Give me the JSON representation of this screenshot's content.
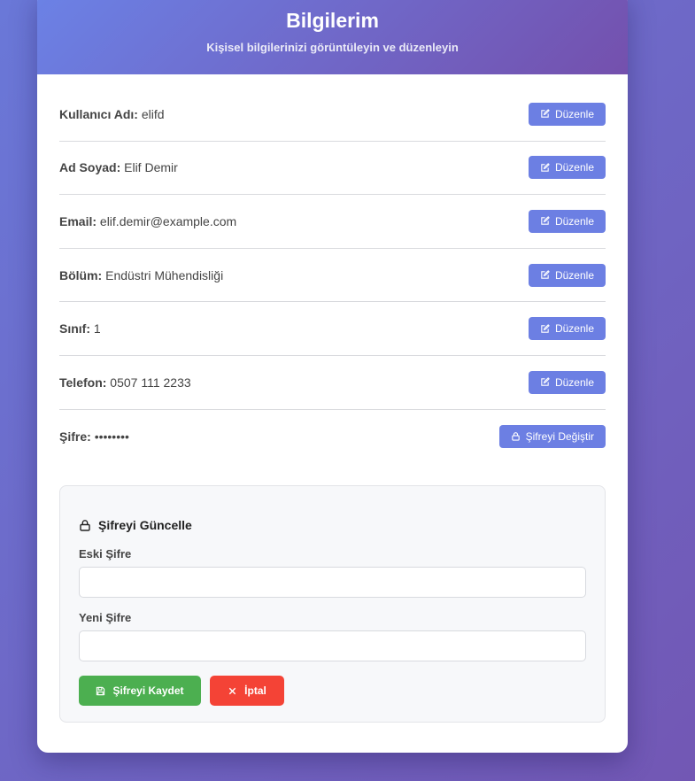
{
  "header": {
    "title": "Bilgilerim",
    "subtitle": "Kişisel bilgilerinizi görüntüleyin ve düzenleyin"
  },
  "fields": [
    {
      "label": "Kullanıcı Adı:",
      "value": "elifd",
      "button": "Düzenle"
    },
    {
      "label": "Ad Soyad:",
      "value": "Elif Demir",
      "button": "Düzenle"
    },
    {
      "label": "Email:",
      "value": "elif.demir@example.com",
      "button": "Düzenle"
    },
    {
      "label": "Bölüm:",
      "value": "Endüstri Mühendisliği",
      "button": "Düzenle"
    },
    {
      "label": "Sınıf:",
      "value": "1",
      "button": "Düzenle"
    },
    {
      "label": "Telefon:",
      "value": "0507 111 2233",
      "button": "Düzenle"
    },
    {
      "label": "Şifre:",
      "value": "••••••••",
      "button": "Şifreyi Değiştir"
    }
  ],
  "password_panel": {
    "title": "Şifreyi Güncelle",
    "old_label": "Eski Şifre",
    "old_value": "",
    "new_label": "Yeni Şifre",
    "new_value": "",
    "save_label": "Şifreyi Kaydet",
    "cancel_label": "İptal"
  },
  "icons": {
    "edit": "edit-icon",
    "lock": "lock-icon",
    "save": "save-icon",
    "close": "close-icon"
  },
  "colors": {
    "primary": "#6c7fe3",
    "save": "#4caf50",
    "cancel": "#f44336"
  }
}
